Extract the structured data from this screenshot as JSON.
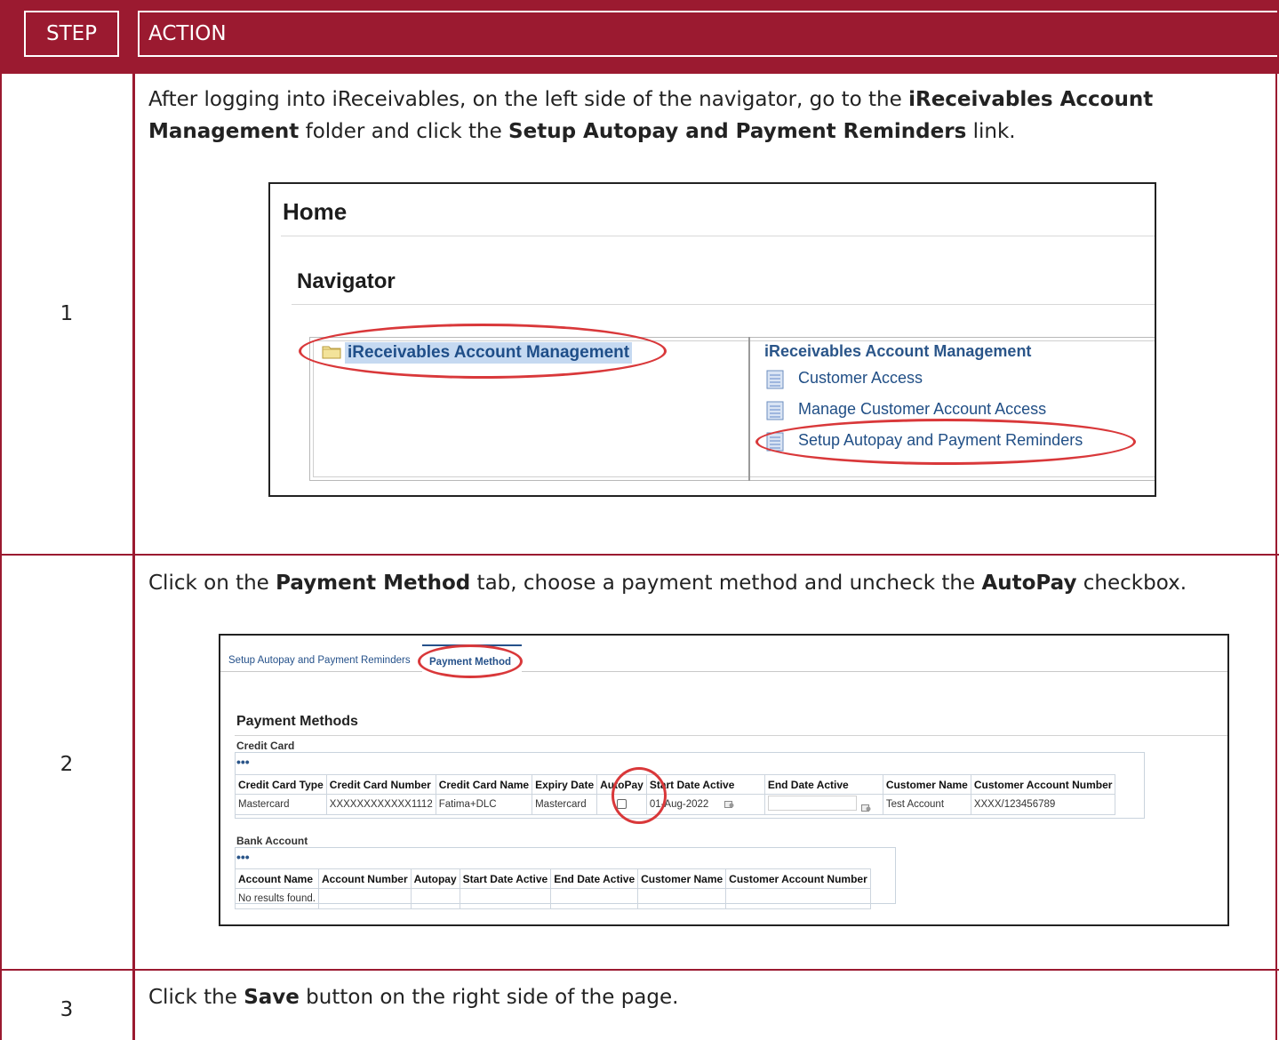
{
  "header": {
    "step_label": "STEP",
    "action_label": "ACTION"
  },
  "steps": [
    {
      "number": "1",
      "text_parts": [
        "After logging into iReceivables, on the left side of the navigator, go to the ",
        "iReceivables Account Management",
        " folder and click the ",
        "Setup Autopay and Payment Reminders",
        " link."
      ],
      "screenshot": {
        "page_title": "Home",
        "section_title": "Navigator",
        "tree_item": "iReceivables Account Management",
        "menu_title": "iReceivables Account Management",
        "menu_items": [
          "Customer Access",
          "Manage Customer Account Access",
          "Setup Autopay and Payment Reminders"
        ]
      }
    },
    {
      "number": "2",
      "text_parts": [
        "Click on the ",
        "Payment Method",
        " tab, choose a payment method and uncheck the ",
        "AutoPay",
        " checkbox."
      ],
      "screenshot": {
        "tab_inactive": "Setup Autopay and Payment Reminders",
        "tab_active": "Payment Method",
        "section_title": "Payment Methods",
        "credit_card": {
          "title": "Credit Card",
          "more": "•••",
          "columns": [
            "Credit Card Type",
            "Credit Card Number",
            "Credit Card Name",
            "Expiry Date",
            "AutoPay",
            "Start Date Active",
            "End Date Active",
            "Customer Name",
            "Customer Account Number"
          ],
          "row": {
            "type": "Mastercard",
            "number": "XXXXXXXXXXXX1112",
            "name": "Fatima+DLC",
            "expiry": "Mastercard",
            "autopay_checked": false,
            "start_date": "01-Aug-2022",
            "end_date": "",
            "customer_name": "Test Account",
            "customer_account_number": "XXXX/123456789"
          }
        },
        "bank_account": {
          "title": "Bank Account",
          "more": "•••",
          "columns": [
            "Account Name",
            "Account Number",
            "Autopay",
            "Start Date Active",
            "End Date Active",
            "Customer Name",
            "Customer Account Number"
          ],
          "empty_text": "No results found."
        }
      }
    },
    {
      "number": "3",
      "text_parts": [
        "Click the ",
        "Save",
        " button on the right side of the page."
      ]
    }
  ],
  "colors": {
    "brand": "#9b1a30",
    "highlight": "#d9383a",
    "link": "#25518a"
  }
}
